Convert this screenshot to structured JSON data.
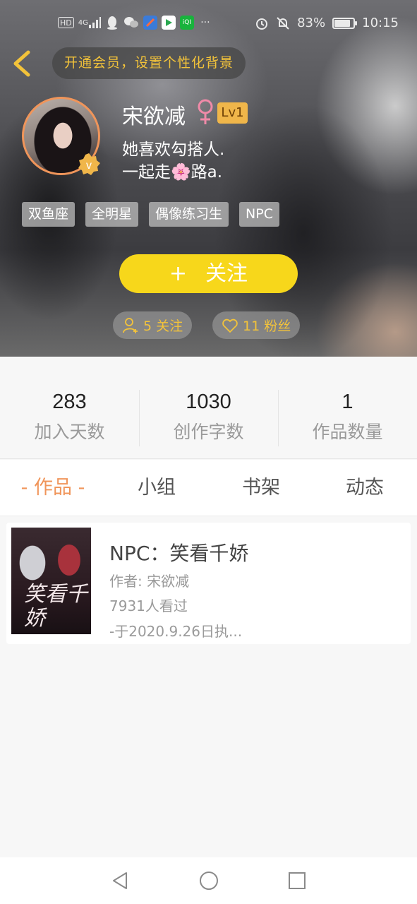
{
  "status_bar": {
    "left_icons": [
      "HD",
      "4G",
      "signal-icon",
      "qq-icon",
      "wechat-icon",
      "browser-icon",
      "play-icon",
      "iqiyi-icon",
      "more-icon"
    ],
    "more": "···",
    "hd": "HD",
    "net": "4G",
    "battery": "83%",
    "battery_level": 0.83,
    "time": "10:15"
  },
  "header": {
    "vip_prompt": "开通会员，设置个性化背景",
    "nickname": "宋欲减",
    "gender_symbol": "♀",
    "level": "Lv1",
    "bio_line1": "她喜欢勾搭人.",
    "bio_line2_prefix": "一起走",
    "bio_flower": "🌸",
    "bio_line2_suffix": "路a.",
    "tags": [
      "双鱼座",
      "全明星",
      "偶像练习生",
      "NPC"
    ],
    "follow_plus": "+",
    "follow_label": "关注",
    "following": "5 关注",
    "fans": "11 粉丝"
  },
  "stats": [
    {
      "value": "283",
      "label": "加入天数"
    },
    {
      "value": "1030",
      "label": "创作字数"
    },
    {
      "value": "1",
      "label": "作品数量"
    }
  ],
  "tabs": [
    {
      "label": "- 作品 -",
      "active": true
    },
    {
      "label": "小组",
      "active": false
    },
    {
      "label": "书架",
      "active": false
    },
    {
      "label": "动态",
      "active": false
    }
  ],
  "works": [
    {
      "cover_text": "笑看千娇",
      "title": "NPC：笑看千娇",
      "author": "作者: 宋欲减",
      "views": "7931人看过",
      "excerpt": "-于2020.9.26日执..."
    }
  ],
  "colors": {
    "accent_orange": "#f0955a",
    "follow_yellow": "#f7d71b",
    "vip_gold": "#f3c33a",
    "level_badge": "#f0b64a"
  }
}
